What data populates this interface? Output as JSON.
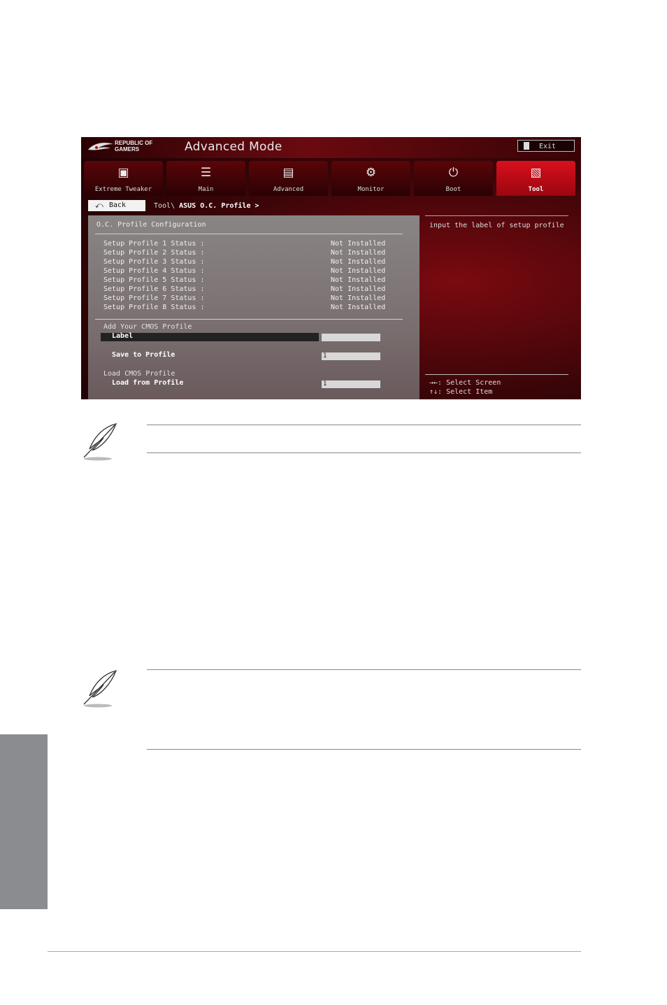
{
  "bios": {
    "brand": "REPUBLIC OF\nGAMERS",
    "mode_title": "Advanced Mode",
    "exit_label": "Exit",
    "tabs": [
      {
        "label": "Extreme Tweaker",
        "icon": "tweaker-icon"
      },
      {
        "label": "Main",
        "icon": "list-icon"
      },
      {
        "label": "Advanced",
        "icon": "advanced-icon"
      },
      {
        "label": "Monitor",
        "icon": "monitor-icon"
      },
      {
        "label": "Boot",
        "icon": "power-icon"
      },
      {
        "label": "Tool",
        "icon": "toolbox-icon"
      }
    ],
    "active_tab": "Tool",
    "back_label": "Back",
    "breadcrumb_prefix": "Tool\\ ",
    "breadcrumb_current": "ASUS O.C. Profile >",
    "section_title": "O.C. Profile Configuration",
    "profiles": [
      {
        "label": "Setup Profile 1 Status :",
        "value": "Not Installed"
      },
      {
        "label": "Setup Profile 2 Status :",
        "value": "Not Installed"
      },
      {
        "label": "Setup Profile 3 Status :",
        "value": "Not Installed"
      },
      {
        "label": "Setup Profile 4 Status :",
        "value": "Not Installed"
      },
      {
        "label": "Setup Profile 5 Status :",
        "value": "Not Installed"
      },
      {
        "label": "Setup Profile 6 Status :",
        "value": "Not Installed"
      },
      {
        "label": "Setup Profile 7 Status :",
        "value": "Not Installed"
      },
      {
        "label": "Setup Profile 8 Status :",
        "value": "Not Installed"
      }
    ],
    "add_group_label": "Add Your CMOS Profile",
    "label_item": "Label",
    "label_value": "",
    "save_item": "Save to Profile",
    "save_value": "1",
    "load_group_label": "Load CMOS Profile",
    "load_item": "Load from Profile",
    "load_value": "1",
    "help_text": "input the label of setup profile",
    "key_hints": [
      "→←: Select Screen",
      "↑↓: Select Item"
    ]
  },
  "colors": {
    "accent_red": "#d8101c",
    "side_tab": "#8a8c90"
  }
}
